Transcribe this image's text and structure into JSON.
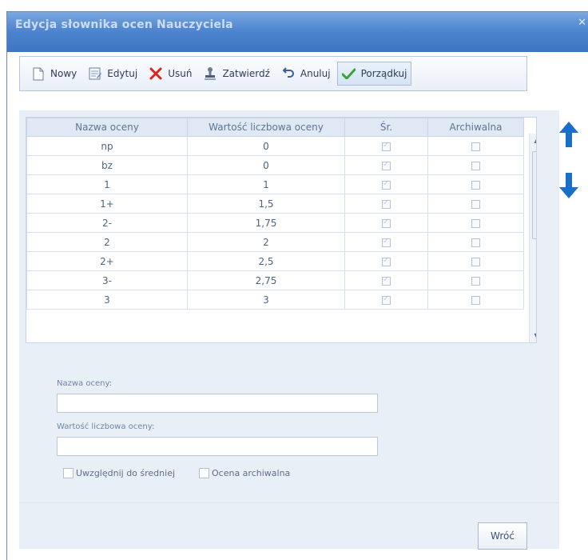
{
  "window": {
    "title": "Edycja słownika ocen Nauczyciela"
  },
  "toolbar": {
    "buttons": [
      {
        "label": "Nowy"
      },
      {
        "label": "Edytuj"
      },
      {
        "label": "Usuń"
      },
      {
        "label": "Zatwierdź"
      },
      {
        "label": "Anuluj"
      },
      {
        "label": "Porządkuj"
      }
    ]
  },
  "grid": {
    "headers": [
      "Nazwa oceny",
      "Wartość liczbowa oceny",
      "Śr.",
      "Archiwalna"
    ],
    "rows": [
      {
        "name": "np",
        "value": "0",
        "avg": true,
        "archived": false
      },
      {
        "name": "bz",
        "value": "0",
        "avg": true,
        "archived": false
      },
      {
        "name": "1",
        "value": "1",
        "avg": true,
        "archived": false
      },
      {
        "name": "1+",
        "value": "1,5",
        "avg": true,
        "archived": false
      },
      {
        "name": "2-",
        "value": "1,75",
        "avg": true,
        "archived": false
      },
      {
        "name": "2",
        "value": "2",
        "avg": true,
        "archived": false
      },
      {
        "name": "2+",
        "value": "2,5",
        "avg": true,
        "archived": false
      },
      {
        "name": "3-",
        "value": "2,75",
        "avg": true,
        "archived": false
      },
      {
        "name": "3",
        "value": "3",
        "avg": true,
        "archived": false
      }
    ]
  },
  "form": {
    "name_label": "Nazwa oceny:",
    "name_value": "",
    "value_label": "Wartość liczbowa oceny:",
    "value_value": "",
    "include_avg_label": "Uwzględnij do średniej",
    "archived_label": "Ocena archiwalna"
  },
  "footer": {
    "back_label": "Wróć"
  },
  "colors": {
    "accent": "#1a6fc9",
    "title_bar": "#4f86cf",
    "delete": "#d9241c",
    "confirm": "#3aa33a"
  }
}
